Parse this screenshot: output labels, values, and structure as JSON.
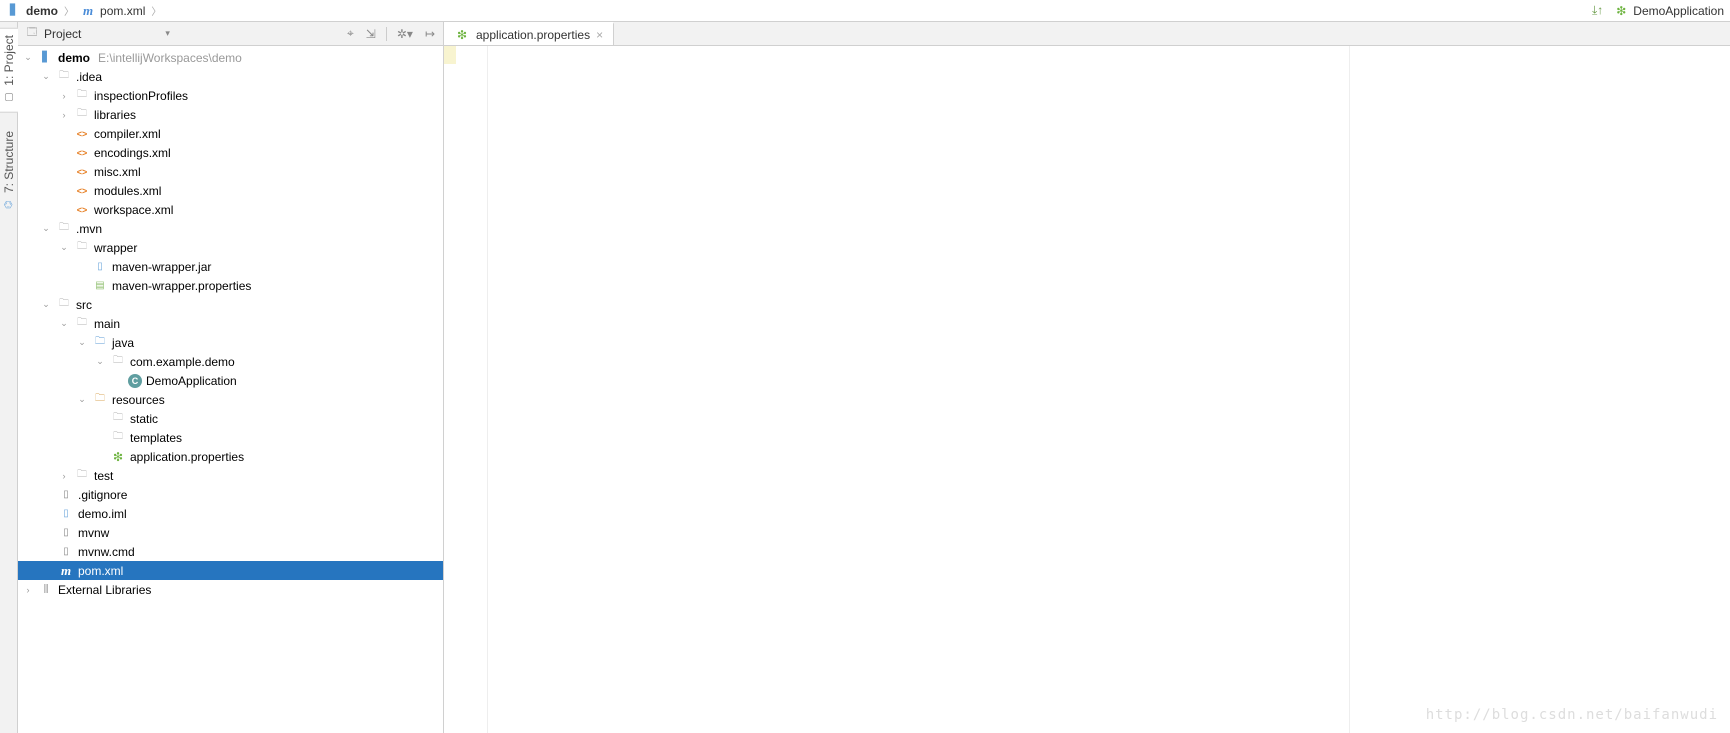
{
  "breadcrumb": {
    "root": "demo",
    "file": "pom.xml"
  },
  "runconfig": {
    "name": "DemoApplication"
  },
  "leftTabs": {
    "project": "1: Project",
    "structure": "7: Structure"
  },
  "projectTool": {
    "title": "Project",
    "ariaCollapse": "Collapse",
    "ariaTarget": "Target",
    "ariaSettings": "Settings",
    "ariaHide": "Hide"
  },
  "tree": {
    "root": {
      "name": "demo",
      "path": "E:\\intellijWorkspaces\\demo"
    },
    "idea": {
      "name": ".idea",
      "inspectionProfiles": "inspectionProfiles",
      "libraries": "libraries",
      "compiler": "compiler.xml",
      "encodings": "encodings.xml",
      "misc": "misc.xml",
      "modules": "modules.xml",
      "workspace": "workspace.xml"
    },
    "mvn": {
      "name": ".mvn",
      "wrapper": "wrapper",
      "jar": "maven-wrapper.jar",
      "props": "maven-wrapper.properties"
    },
    "src": {
      "name": "src",
      "main": "main",
      "java": "java",
      "pkg": "com.example.demo",
      "appClass": "DemoApplication",
      "resources": "resources",
      "static": "static",
      "templates": "templates",
      "appProps": "application.properties",
      "test": "test"
    },
    "files": {
      "gitignore": ".gitignore",
      "iml": "demo.iml",
      "mvnw": "mvnw",
      "mvnwcmd": "mvnw.cmd",
      "pom": "pom.xml"
    },
    "extLib": "External Libraries"
  },
  "editor": {
    "tab": "application.properties"
  },
  "watermark": "http://blog.csdn.net/baifanwudi"
}
